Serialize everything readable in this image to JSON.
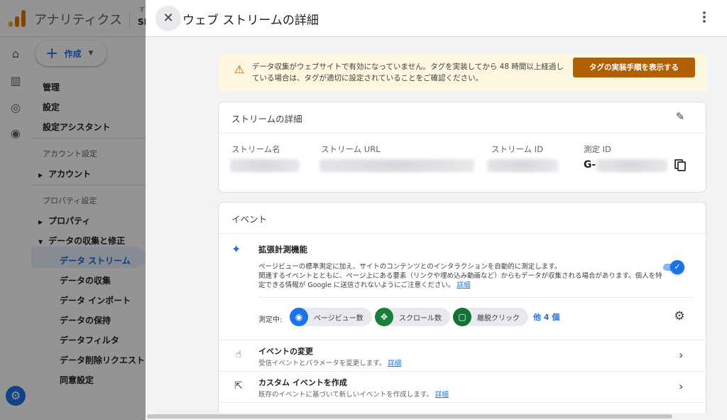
{
  "bg_app": {
    "title": "アナリティクス",
    "account_sub": "す",
    "account_name": "SI",
    "create_label": "作成",
    "nav": {
      "admin": "管理",
      "settings": "設定",
      "setup_assistant": "設定アシスタント",
      "account_section": "アカウント設定",
      "account": "アカウント",
      "property_section": "プロパティ設定",
      "property": "プロパティ",
      "data_collection_modify": "データの収集と修正",
      "data_streams": "データ ストリーム",
      "data_collection": "データの収集",
      "data_import": "データ インポート",
      "data_retention": "データの保持",
      "data_filters": "データフィルタ",
      "data_deletion": "データ削除リクエスト",
      "consent_settings": "同意設定"
    }
  },
  "panel": {
    "title": "ウェブ ストリームの詳細",
    "alert": {
      "text": "データ収集がウェブサイトで有効になっていません。タグを実装してから 48 時間以上経過している場合は、タグが適切に設定されていることをご確認ください。",
      "button": "タグの実装手順を表示する"
    },
    "stream_details": {
      "title": "ストリームの詳細",
      "fields": {
        "stream_name_label": "ストリーム名",
        "stream_url_label": "ストリーム URL",
        "stream_id_label": "ストリーム ID",
        "measurement_id_label": "測定 ID",
        "measurement_id_prefix": "G-"
      }
    },
    "events": {
      "title": "イベント",
      "enhanced": {
        "title": "拡張計測機能",
        "description": "ページビューの標準測定に加え、サイトのコンテンツとのインタラクションを自動的に測定します。",
        "description2": "関連するイベントとともに、ページ上にある要素（リンクや埋め込み動画など）からもデータが収集される場合があります。個人を特定できる情報が Google に送信されないようにご注意ください。",
        "details_link": "詳細",
        "toggle_on": true,
        "measuring_label": "測定中:",
        "chips": [
          {
            "label": "ページビュー数",
            "icon": "eye-icon",
            "color": "#1a73e8"
          },
          {
            "label": "スクロール数",
            "icon": "scroll-icon",
            "color": "#188038"
          },
          {
            "label": "離脱クリック",
            "icon": "mouse-icon",
            "color": "#137333"
          }
        ],
        "more": "他 4 個"
      },
      "rows": [
        {
          "title": "イベントの変更",
          "subtitle": "受信イベントとパラメータを変更します。",
          "link": "詳細",
          "icon": "touch-icon"
        },
        {
          "title": "カスタム イベントを作成",
          "subtitle": "既存のイベントに基づいて新しいイベントを作成します。",
          "link": "詳細",
          "icon": "click-sparkle-icon"
        }
      ]
    }
  },
  "colors": {
    "accent": "#1a73e8",
    "warning_bg": "#fef7e0",
    "warning_button": "#b06000"
  }
}
